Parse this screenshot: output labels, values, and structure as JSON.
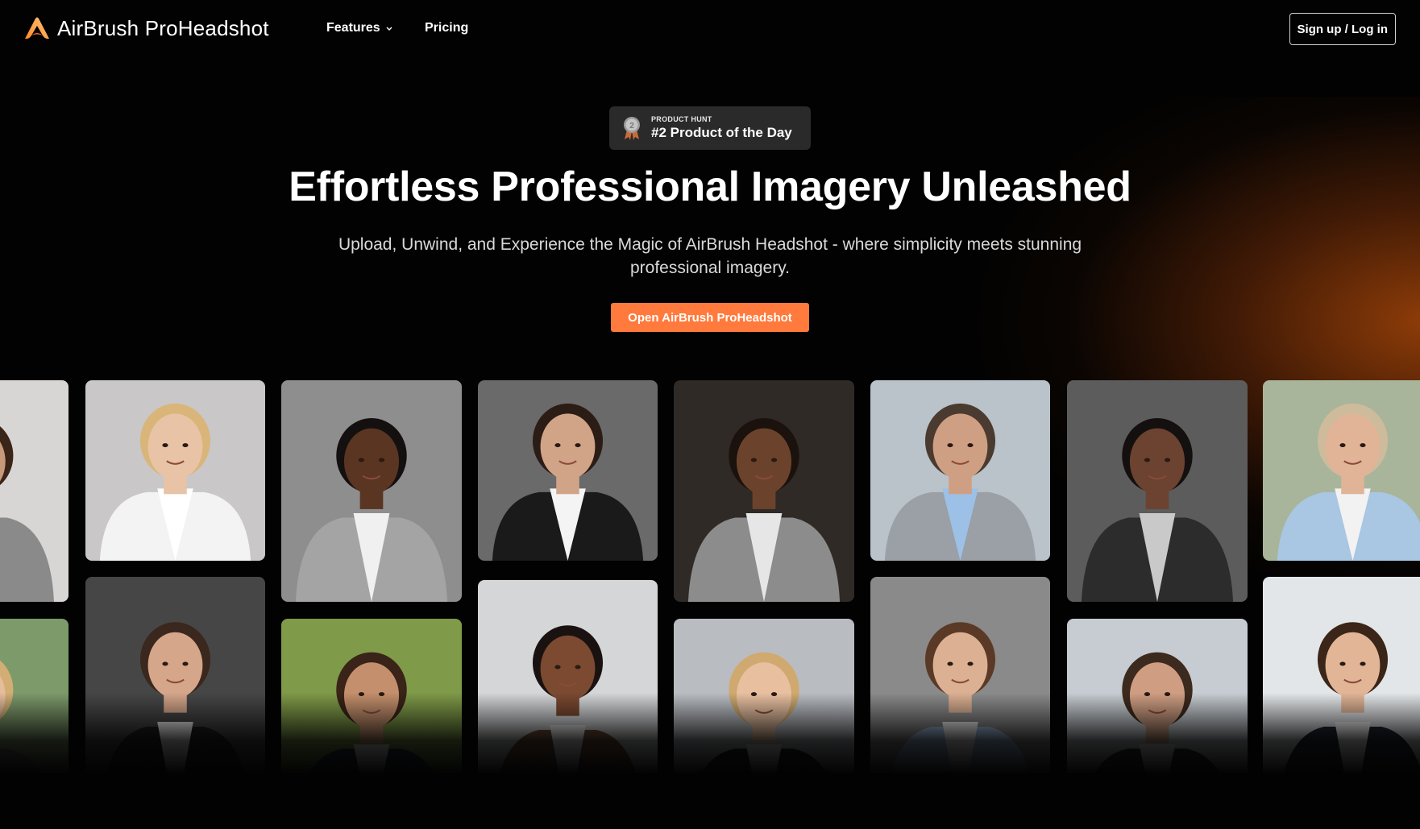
{
  "brand": {
    "name": "AirBrush ProHeadshot",
    "accent": "#ff7a3c"
  },
  "nav": {
    "features_label": "Features",
    "pricing_label": "Pricing",
    "signup_label": "Sign up / Log in"
  },
  "badge": {
    "eyebrow": "PRODUCT HUNT",
    "title": "#2 Product of the Day",
    "medal_number": "2"
  },
  "hero": {
    "title": "Effortless Professional Imagery Unleashed",
    "subtitle": "Upload, Unwind, and Experience the Magic of AirBrush Headshot - where simplicity meets stunning professional imagery.",
    "cta_label": "Open AirBrush ProHeadshot"
  },
  "gallery": {
    "photos": [
      {
        "name": "headshot-woman-gray-blazer",
        "bg": "#d8d6d4",
        "skin": "#c99a7a",
        "hair": "#3b2418",
        "suit": "#8a8a8a",
        "shirt": "#e8e8e8"
      },
      {
        "name": "headshot-blonde-woman-white-shirt",
        "bg": "#c9c7c8",
        "skin": "#e8c3a5",
        "hair": "#d9b57a",
        "suit": "#f3f3f3",
        "shirt": "#ffffff"
      },
      {
        "name": "headshot-man-gray-suit",
        "bg": "#8e8e8e",
        "skin": "#5a3522",
        "hair": "#141010",
        "suit": "#a4a4a4",
        "shirt": "#f0f0f0"
      },
      {
        "name": "headshot-man-black-suit",
        "bg": "#6a6a6a",
        "skin": "#d2a487",
        "hair": "#2b1d16",
        "suit": "#1a1a1a",
        "shirt": "#f4f4f4"
      },
      {
        "name": "headshot-woman-bookshelf",
        "bg": "#2f2a26",
        "skin": "#6b432d",
        "hair": "#1c120d",
        "suit": "#8c8c8c",
        "shirt": "#e6e6e6"
      },
      {
        "name": "headshot-man-window-light",
        "bg": "#b9c3c9",
        "skin": "#cf9f84",
        "hair": "#4a3a30",
        "suit": "#9aa0a6",
        "shirt": "#9dc0e6"
      },
      {
        "name": "headshot-man-dark-suit",
        "bg": "#5c5c5c",
        "skin": "#6b4330",
        "hair": "#151010",
        "suit": "#2c2c2c",
        "shirt": "#c9c9c9"
      },
      {
        "name": "headshot-older-woman-outdoor",
        "bg": "#a8b59a",
        "skin": "#e1b497",
        "hair": "#cdbb9c",
        "suit": "#a9c6e2",
        "shirt": "#f2f2f2"
      },
      {
        "name": "headshot-blonde-woman-outdoor",
        "bg": "#7d9a6b",
        "skin": "#e6bd9c",
        "hair": "#d2ad74",
        "suit": "#6a6a6a",
        "shirt": "#ededed"
      },
      {
        "name": "headshot-man-black-suit-smiling",
        "bg": "#464646",
        "skin": "#d6a68a",
        "hair": "#3a271d",
        "suit": "#1b1b1b",
        "shirt": "#f0f0f0"
      },
      {
        "name": "headshot-woman-park",
        "bg": "#7f9a48",
        "skin": "#c48f6c",
        "hair": "#3a2318",
        "suit": "#222a38",
        "shirt": "#f1f1f1"
      },
      {
        "name": "headshot-woman-brown-blazer",
        "bg": "#d4d6d8",
        "skin": "#7b4a31",
        "hair": "#191210",
        "suit": "#6e4b34",
        "shirt": "#f3f3f3"
      },
      {
        "name": "headshot-blonde-woman-black-blazer",
        "bg": "#b9bdc2",
        "skin": "#e8c0a0",
        "hair": "#cfa970",
        "suit": "#1e1e22",
        "shirt": "#f1f1f1"
      },
      {
        "name": "headshot-woman-light-blue-blazer",
        "bg": "#8a8a8a",
        "skin": "#dcb092",
        "hair": "#5a3a26",
        "suit": "#9db8da",
        "shirt": "#f2f2f2"
      },
      {
        "name": "headshot-man-office",
        "bg": "#c6ccd1",
        "skin": "#cf9e82",
        "hair": "#3d2a1e",
        "suit": "#2a2c33",
        "shirt": "#f1f1f1"
      },
      {
        "name": "headshot-young-man-navy-jacket",
        "bg": "#e3e6e8",
        "skin": "#e1b596",
        "hair": "#3a2518",
        "suit": "#1f2433",
        "shirt": "#ffffff"
      }
    ]
  }
}
